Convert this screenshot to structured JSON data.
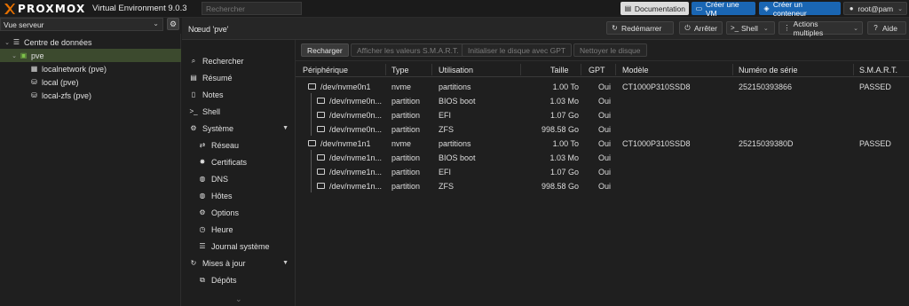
{
  "header": {
    "logo_text": "PROXMOX",
    "product_title": "Virtual Environment 9.0.3",
    "search_placeholder": "Rechercher",
    "buttons": {
      "documentation": "Documentation",
      "create_vm": "Créer une VM",
      "create_ct": "Créer un conteneur",
      "user": "root@pam"
    }
  },
  "view_selector": {
    "value": "Vue serveur"
  },
  "tree": {
    "datacenter": "Centre de données",
    "node": "pve",
    "children": [
      "localnetwork (pve)",
      "local (pve)",
      "local-zfs (pve)"
    ]
  },
  "node_header": {
    "title": "Nœud 'pve'",
    "buttons": {
      "reboot": "Redémarrer",
      "shutdown": "Arrêter",
      "shell": "Shell",
      "bulk": "Actions multiples",
      "help": "Aide"
    }
  },
  "nav": {
    "items": [
      "Rechercher",
      "Résumé",
      "Notes",
      "Shell",
      "Système",
      "Réseau",
      "Certificats",
      "DNS",
      "Hôtes",
      "Options",
      "Heure",
      "Journal système",
      "Mises à jour",
      "Dépôts"
    ]
  },
  "toolbar": {
    "reload": "Recharger",
    "smart": "Afficher les valeurs S.M.A.R.T.",
    "gpt": "Initialiser le disque avec GPT",
    "wipe": "Nettoyer le disque"
  },
  "table": {
    "columns": [
      "Périphérique",
      "Type",
      "Utilisation",
      "Taille",
      "GPT",
      "Modèle",
      "Numéro de série",
      "S.M.A.R.T."
    ],
    "rows": [
      [
        "/dev/nvme0n1",
        "nvme",
        "partitions",
        "1.00 To",
        "Oui",
        "CT1000P310SSD8",
        "25215039386​6",
        "PASSED"
      ],
      [
        "/dev/nvme0n...",
        "partition",
        "BIOS boot",
        "1.03 Mo",
        "Oui",
        "",
        "",
        ""
      ],
      [
        "/dev/nvme0n...",
        "partition",
        "EFI",
        "1.07 Go",
        "Oui",
        "",
        "",
        ""
      ],
      [
        "/dev/nvme0n...",
        "partition",
        "ZFS",
        "998.58 Go",
        "Oui",
        "",
        "",
        ""
      ],
      [
        "/dev/nvme1n1",
        "nvme",
        "partitions",
        "1.00 To",
        "Oui",
        "CT1000P310SSD8",
        "25215039380D",
        "PASSED"
      ],
      [
        "/dev/nvme1n...",
        "partition",
        "BIOS boot",
        "1.03 Mo",
        "Oui",
        "",
        "",
        ""
      ],
      [
        "/dev/nvme1n...",
        "partition",
        "EFI",
        "1.07 Go",
        "Oui",
        "",
        "",
        ""
      ],
      [
        "/dev/nvme1n...",
        "partition",
        "ZFS",
        "998.58 Go",
        "Oui",
        "",
        "",
        ""
      ]
    ]
  },
  "colors": {
    "accent_orange": "#e57000",
    "primary_blue": "#1a66b3",
    "selection_green": "#3c4a2e"
  }
}
